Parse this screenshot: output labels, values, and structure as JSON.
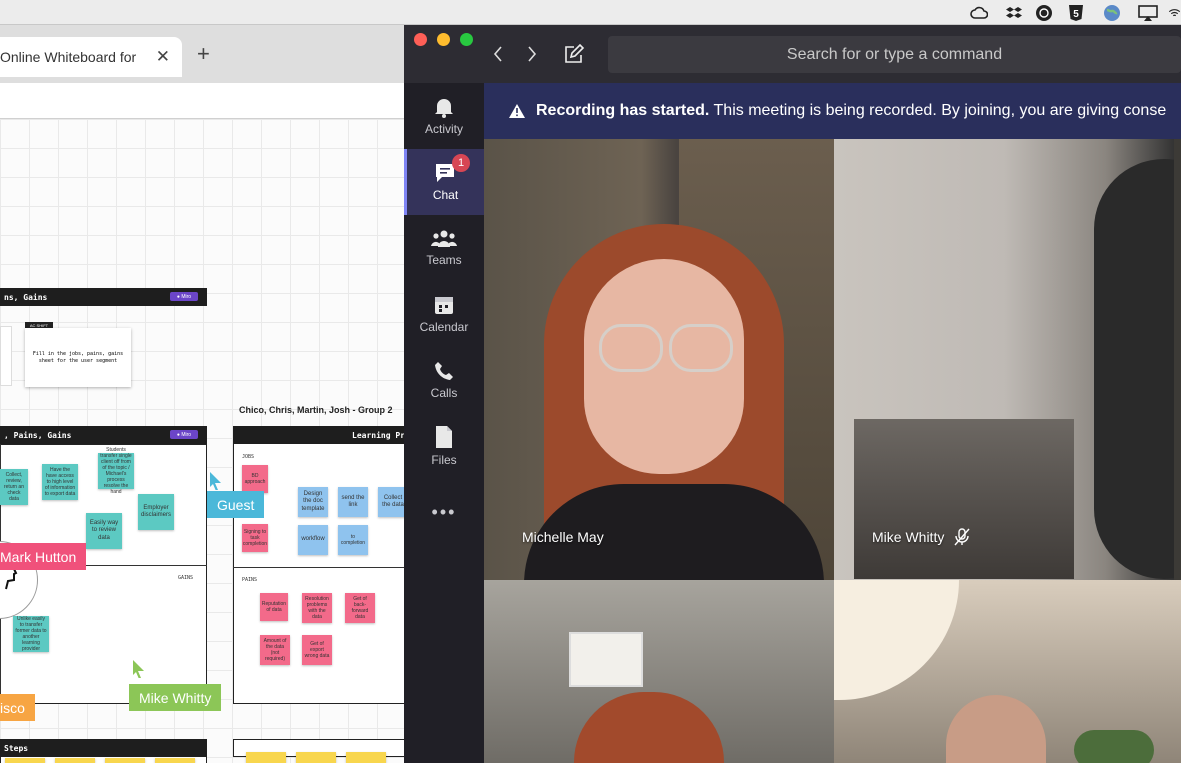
{
  "menubar": {
    "icons": [
      "creative-cloud-icon",
      "dropbox-icon",
      "vpn-globe-icon",
      "s-badge-icon",
      "browser-globe-icon",
      "airplay-icon",
      "wifi-icon"
    ]
  },
  "browser": {
    "tab_title": "Online Whiteboard for",
    "close_symbol": "✕",
    "new_tab_symbol": "+"
  },
  "board": {
    "frame1_title": "ns, Gains",
    "frame1_pill": "● Miro",
    "frame1_card_text": "Fill in the jobs, pains, gains sheet for the user segment",
    "frame1_card_tag": "AC SHIFT",
    "group_title": "Chico, Chris, Martin, Josh  - Group 2",
    "frame2_title": ", Pains, Gains",
    "frame2_pill": "● Miro",
    "frame2_gains_label": "GAINS",
    "frame3_title": "Learning Pr",
    "frame3_jobs_label": "JOBS",
    "frame3_pains_label": "PAINS",
    "frame4_title": "Steps",
    "stickies_left": [
      "Collect, review, return an check data",
      "Have the have access to high level of information to export data",
      "Students transfer single client off from of the topic / Michael's process resolve the hand",
      "Easily way to review data",
      "Employer disclaimers",
      "Unlike easily to transfer former data to another learning provider"
    ],
    "stickies_right": [
      "BD approach",
      "Design the doc template",
      "send the link",
      "Collect the data",
      "Signing to task completion",
      "workflow",
      "to completion"
    ],
    "stickies_pains": [
      "Reputation of data",
      "Resolution problems with the data",
      "Get of back-forward data",
      "Amount of the data (not required)",
      "Get of export wrong data"
    ],
    "cursors": {
      "guest": "Guest",
      "mark": "Mark Hutton",
      "mike": "Mike Whitty",
      "orange": "isco"
    }
  },
  "teams": {
    "search_placeholder": "Search for or type a command",
    "rail": [
      {
        "label": "Activity",
        "icon": "bell-icon"
      },
      {
        "label": "Chat",
        "icon": "chat-icon",
        "badge": "1"
      },
      {
        "label": "Teams",
        "icon": "teams-icon"
      },
      {
        "label": "Calendar",
        "icon": "calendar-icon"
      },
      {
        "label": "Calls",
        "icon": "phone-icon"
      },
      {
        "label": "Files",
        "icon": "file-icon"
      },
      {
        "label": "•••",
        "icon": "more-icon"
      }
    ],
    "banner_bold": "Recording has started.",
    "banner_text": " This meeting is being recorded. By joining, you are giving conse",
    "participants": [
      {
        "name": "Michelle May",
        "muted": false
      },
      {
        "name": "Mike Whitty",
        "muted": true
      }
    ],
    "colors": {
      "accent": "#7f85f5",
      "banner": "#2a2f5c",
      "badge": "#d74654"
    }
  }
}
